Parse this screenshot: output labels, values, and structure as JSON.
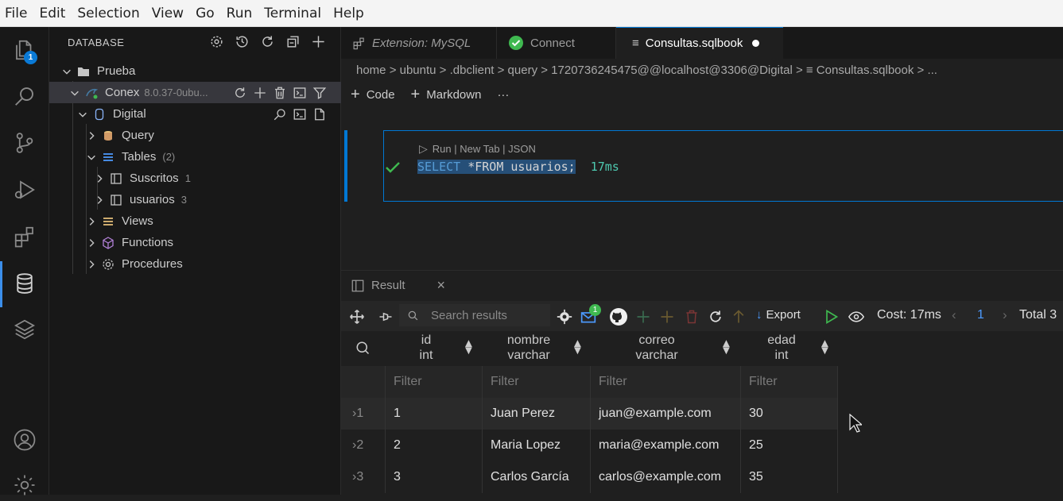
{
  "menu": [
    "File",
    "Edit",
    "Selection",
    "View",
    "Go",
    "Run",
    "Terminal",
    "Help"
  ],
  "activity": {
    "explorer_badge": "1"
  },
  "sidebar": {
    "title": "DATABASE",
    "tree": {
      "connection_group": "Prueba",
      "connection": {
        "name": "Conex",
        "version": "8.0.37-0ubu..."
      },
      "database": "Digital",
      "query": "Query",
      "tables": {
        "label": "Tables",
        "count": "(2)"
      },
      "table_items": [
        {
          "name": "Suscritos",
          "count": "1"
        },
        {
          "name": "usuarios",
          "count": "3"
        }
      ],
      "views": "Views",
      "functions": "Functions",
      "procedures": "Procedures"
    }
  },
  "tabs": [
    {
      "label": "Extension: MySQL"
    },
    {
      "label": "Connect"
    },
    {
      "label": "Consultas.sqlbook"
    }
  ],
  "breadcrumb": "home > ubuntu > .dbclient > query > 1720736245475@@localhost@3306@Digital > ≡ Consultas.sqlbook > ...",
  "notebook": {
    "add_code": "Code",
    "add_markdown": "Markdown",
    "more": "···",
    "codelens": "Run | New Tab | JSON",
    "code_keyword": "SELECT",
    "code_rest": " *FROM usuarios;",
    "duration": "17ms"
  },
  "result": {
    "tab_label": "Result",
    "search_placeholder": "Search results",
    "toolbar_badge": "1",
    "export_label": "Export",
    "cost": "Cost: 17ms",
    "page": "1",
    "total": "Total 3",
    "columns": [
      {
        "name": "id",
        "type": "int"
      },
      {
        "name": "nombre",
        "type": "varchar"
      },
      {
        "name": "correo",
        "type": "varchar"
      },
      {
        "name": "edad",
        "type": "int"
      }
    ],
    "filter_placeholder": "Filter",
    "rows": [
      {
        "n": "1",
        "id": "1",
        "nombre": "Juan Perez",
        "correo": "juan@example.com",
        "edad": "30"
      },
      {
        "n": "2",
        "id": "2",
        "nombre": "Maria Lopez",
        "correo": "maria@example.com",
        "edad": "25"
      },
      {
        "n": "3",
        "id": "3",
        "nombre": "Carlos García",
        "correo": "carlos@example.com",
        "edad": "35"
      }
    ]
  },
  "colors": {
    "accent": "#0078d4",
    "success": "#3fb950",
    "keyword_sql": "#569cd6",
    "duration": "#4ec9b0"
  }
}
